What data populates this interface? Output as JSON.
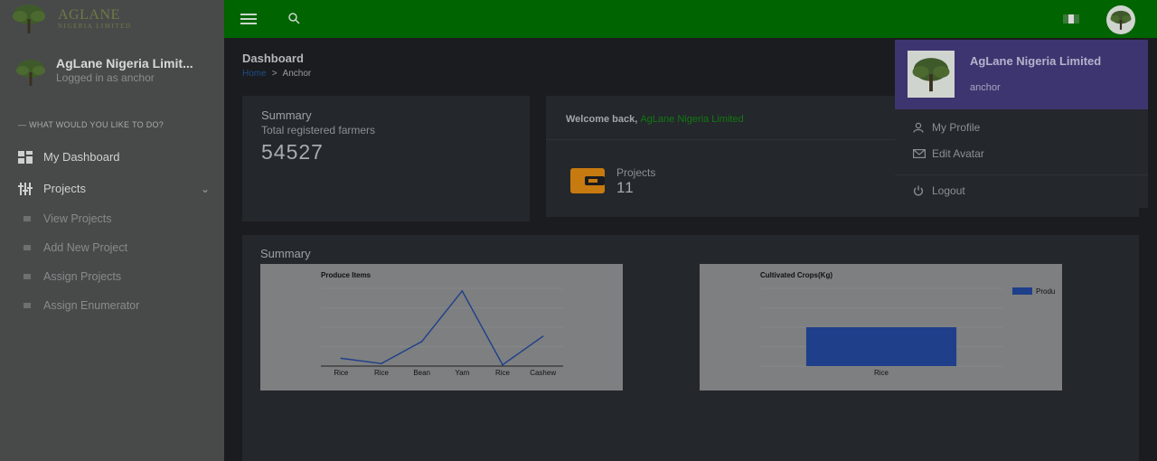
{
  "brand": {
    "name": "AGLANE",
    "subtitle": "NIGERIA LIMITED"
  },
  "sidebar": {
    "user_name": "AgLane  Nigeria Limit...",
    "user_status": "Logged in as anchor",
    "section_label": "— WHAT WOULD YOU LIKE TO DO?",
    "items": [
      {
        "label": "My Dashboard",
        "icon": "dashboard-icon"
      },
      {
        "label": "Projects",
        "icon": "sliders-icon"
      }
    ],
    "sub_items": [
      "View Projects",
      "Add New Project",
      "Assign Projects",
      "Assign Enumerator"
    ]
  },
  "page": {
    "title": "Dashboard",
    "breadcrumb": {
      "home": "Home",
      "separator": ">",
      "current": "Anchor"
    }
  },
  "summary_card": {
    "title": "Summary",
    "subtitle": "Total registered farmers",
    "value": "54527"
  },
  "welcome_card": {
    "prefix": "Welcome back,",
    "name": "AgLane  Nigeria Limited",
    "projects_label": "Projects",
    "projects_value": "11"
  },
  "summary_section": {
    "title": "Summary"
  },
  "dropdown": {
    "name": "AgLane  Nigeria Limited",
    "role": "anchor",
    "items": [
      {
        "label": "My Profile",
        "icon": "user-icon"
      },
      {
        "label": "Edit Avatar",
        "icon": "envelope-icon"
      },
      {
        "label": "Logout",
        "icon": "power-icon"
      }
    ]
  },
  "colors": {
    "topbar": "#006400",
    "accent_green": "#117811",
    "dropdown_header": "#3d3570",
    "series": "#1f3f8a",
    "wallet": "#c77a10"
  },
  "chart_data": [
    {
      "type": "line",
      "title": "Produce Items",
      "categories": [
        "Rice",
        "Rice",
        "Bean",
        "Yam",
        "Rice",
        "Cashew"
      ],
      "series": [
        {
          "values": [
            6,
            2,
            19,
            58,
            1,
            23
          ]
        }
      ],
      "ylim": [
        0,
        60
      ],
      "grid": true
    },
    {
      "type": "bar",
      "title": "Cultivated Crops(Kg)",
      "categories": [
        "Rice"
      ],
      "series": [
        {
          "name": "Produ",
          "values": [
            1
          ]
        }
      ],
      "ylim": [
        0,
        2
      ],
      "grid": true,
      "legend": "top-right"
    }
  ]
}
